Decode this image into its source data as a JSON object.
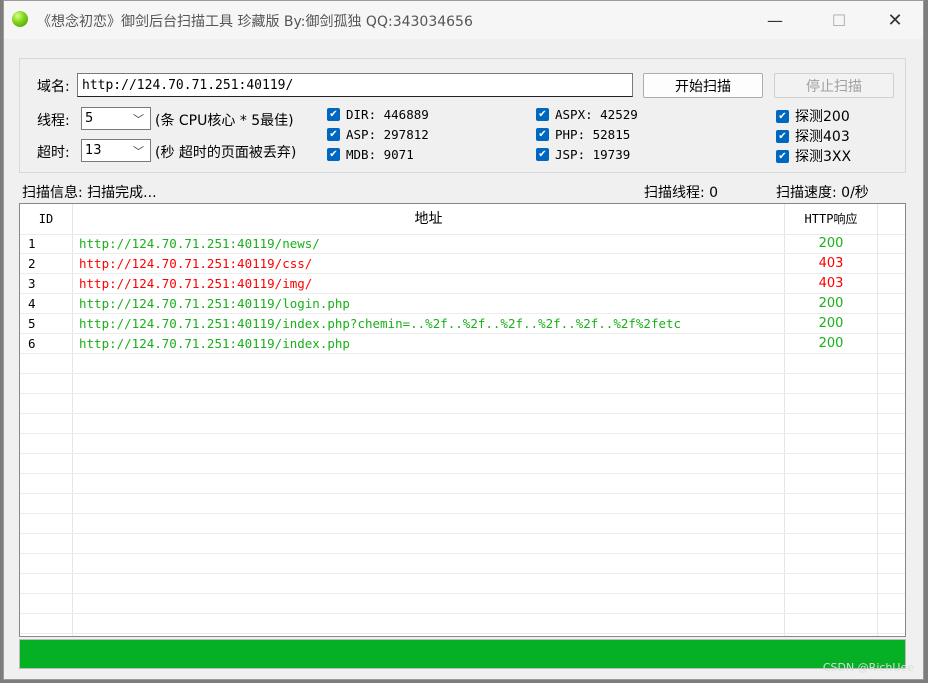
{
  "window": {
    "title": "《想念初恋》御剑后台扫描工具 珍藏版 By:御剑孤独 QQ:343034656",
    "min_glyph": "—",
    "max_glyph": "☐",
    "close_glyph": "✕"
  },
  "form": {
    "domain_label": "域名:",
    "domain_value": "http://124.70.71.251:40119/",
    "start_button": "开始扫描",
    "stop_button": "停止扫描",
    "threads_label": "线程:",
    "threads_value": "5",
    "threads_hint": "(条 CPU核心 * 5最佳)",
    "timeout_label": "超时:",
    "timeout_value": "13",
    "timeout_hint": "(秒 超时的页面被丢弃)"
  },
  "dicts": [
    {
      "label": "DIR: 446889",
      "checked": true
    },
    {
      "label": "ASP: 297812",
      "checked": true
    },
    {
      "label": "MDB: 9071",
      "checked": true
    },
    {
      "label": "ASPX: 42529",
      "checked": true
    },
    {
      "label": "PHP: 52815",
      "checked": true
    },
    {
      "label": "JSP: 19739",
      "checked": true
    },
    {
      "label": "探测200",
      "checked": true
    },
    {
      "label": "探测403",
      "checked": true
    },
    {
      "label": "探测3XX",
      "checked": true
    }
  ],
  "status": {
    "info": "扫描信息: 扫描完成...",
    "threads": "扫描线程: 0",
    "speed": "扫描速度: 0/秒"
  },
  "table": {
    "headers": {
      "id": "ID",
      "address": "地址",
      "http": "HTTP响应"
    },
    "rows": [
      {
        "id": "1",
        "url": "http://124.70.71.251:40119/news/",
        "code": "200"
      },
      {
        "id": "2",
        "url": "http://124.70.71.251:40119/css/",
        "code": "403"
      },
      {
        "id": "3",
        "url": "http://124.70.71.251:40119/img/",
        "code": "403"
      },
      {
        "id": "4",
        "url": "http://124.70.71.251:40119/login.php",
        "code": "200"
      },
      {
        "id": "5",
        "url": "http://124.70.71.251:40119/index.php?chemin=..%2f..%2f..%2f..%2f..%2f..%2f%2fetc",
        "code": "200"
      },
      {
        "id": "6",
        "url": "http://124.70.71.251:40119/index.php",
        "code": "200"
      }
    ],
    "empty_rows": 14
  },
  "progress": {
    "value": 1.0
  },
  "colors": {
    "ok": "#1aaf1a",
    "forbidden": "#ff0000",
    "progress": "#06b025",
    "check": "#0067c0"
  },
  "watermark": "CSDN @RichUee"
}
